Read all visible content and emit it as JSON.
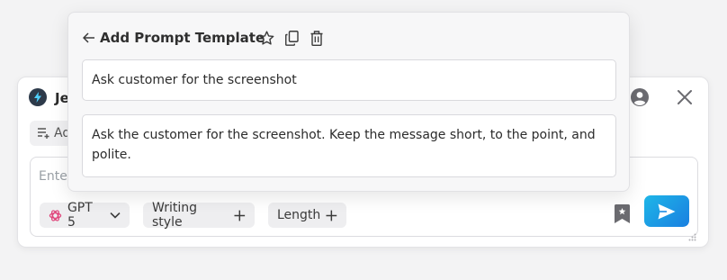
{
  "composer": {
    "app_title": "Je",
    "add_chip_label": "Ad",
    "message_placeholder": "Ente",
    "model_label": "GPT 5",
    "writing_style_label": "Writing style",
    "length_label": "Length"
  },
  "popover": {
    "title": "Add Prompt Template",
    "template_name": "Ask customer for the screenshot",
    "template_body": "Ask the customer for the screenshot. Keep the message short, to the point, and polite."
  },
  "icons": {
    "app_logo": "lightning-bolt-icon",
    "account": "user-circle-icon",
    "close": "close-icon",
    "add_list": "playlist-add-icon",
    "model": "openai-icon",
    "chevron": "chevron-down-icon",
    "plus": "plus-icon",
    "bookmark": "bookmark-star-icon",
    "send": "send-icon",
    "back": "arrow-left-icon",
    "star": "star-icon",
    "copy": "copy-icon",
    "trash": "trash-icon"
  },
  "colors": {
    "send_gradient_start": "#1eb6e8",
    "send_gradient_end": "#1a7fe0",
    "model_icon": "#e0457b"
  }
}
